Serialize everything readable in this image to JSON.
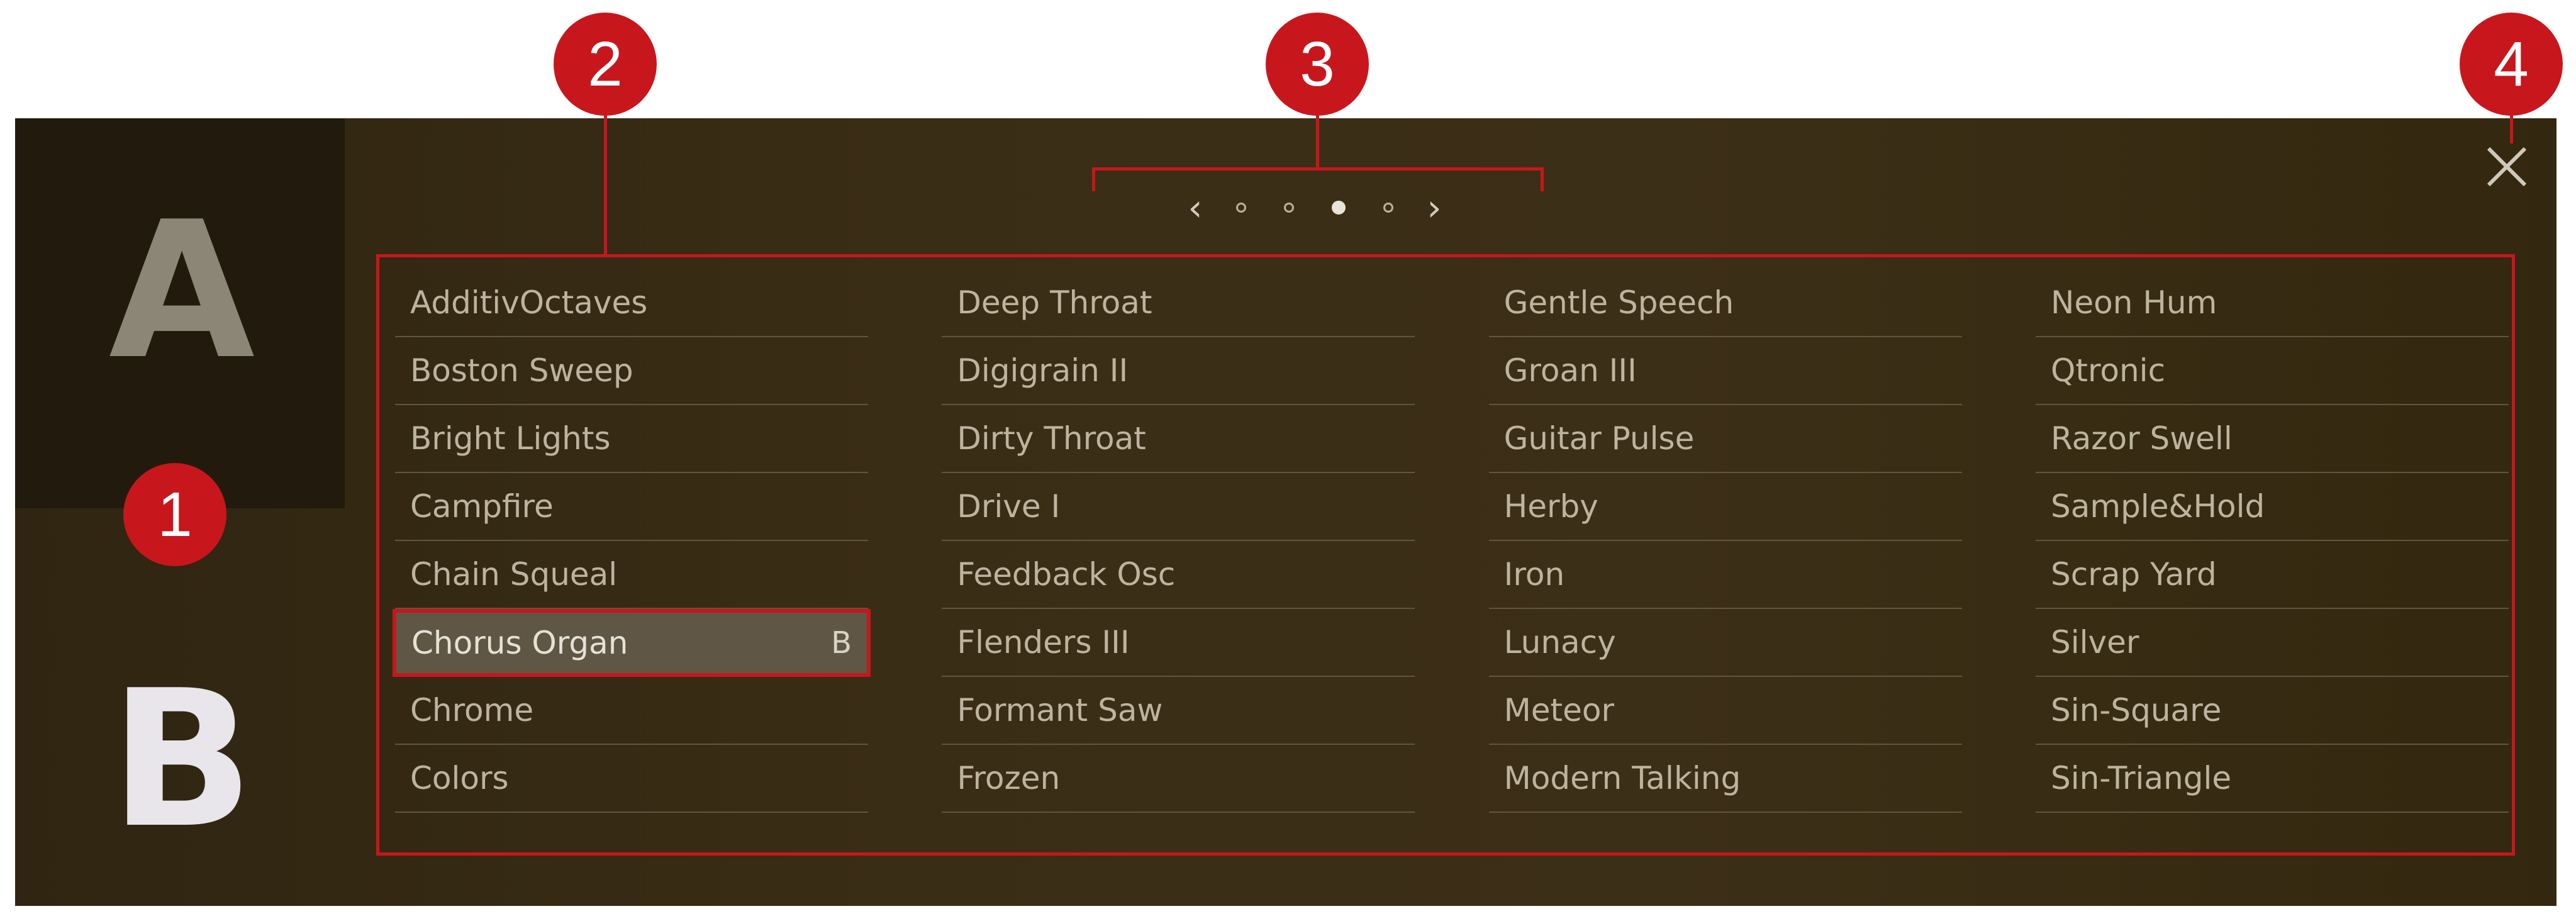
{
  "slots": {
    "a_label": "A",
    "b_label": "B"
  },
  "pager": {
    "prev_icon": "chevron-left-icon",
    "next_icon": "chevron-right-icon",
    "page_count": 4,
    "current_page": 3
  },
  "close_icon": "close-icon",
  "callouts": [
    "1",
    "2",
    "3",
    "4"
  ],
  "columns": [
    {
      "items": [
        {
          "label": "AdditivOctaves"
        },
        {
          "label": "Boston Sweep"
        },
        {
          "label": "Bright Lights"
        },
        {
          "label": "Campfire"
        },
        {
          "label": "Chain Squeal"
        },
        {
          "label": "Chorus Organ",
          "tag": "B",
          "selected": true
        },
        {
          "label": "Chrome"
        },
        {
          "label": "Colors"
        }
      ]
    },
    {
      "items": [
        {
          "label": "Deep Throat"
        },
        {
          "label": "Digigrain II"
        },
        {
          "label": "Dirty Throat"
        },
        {
          "label": "Drive I"
        },
        {
          "label": "Feedback Osc"
        },
        {
          "label": "Flenders III"
        },
        {
          "label": "Formant Saw"
        },
        {
          "label": "Frozen"
        }
      ]
    },
    {
      "items": [
        {
          "label": "Gentle Speech"
        },
        {
          "label": "Groan III"
        },
        {
          "label": "Guitar Pulse"
        },
        {
          "label": "Herby"
        },
        {
          "label": "Iron"
        },
        {
          "label": "Lunacy"
        },
        {
          "label": "Meteor"
        },
        {
          "label": "Modern Talking"
        }
      ]
    },
    {
      "items": [
        {
          "label": "Neon Hum"
        },
        {
          "label": "Qtronic"
        },
        {
          "label": "Razor Swell"
        },
        {
          "label": "Sample&Hold"
        },
        {
          "label": "Scrap Yard"
        },
        {
          "label": "Silver"
        },
        {
          "label": "Sin-Square"
        },
        {
          "label": "Sin-Triangle"
        }
      ]
    }
  ],
  "colors": {
    "accent_red": "#c8161d",
    "panel_bg": "#3a2d15",
    "slot_a_bg": "#221b0d",
    "item_text": "#bdb4a0",
    "selected_bg": "#5f5646"
  }
}
